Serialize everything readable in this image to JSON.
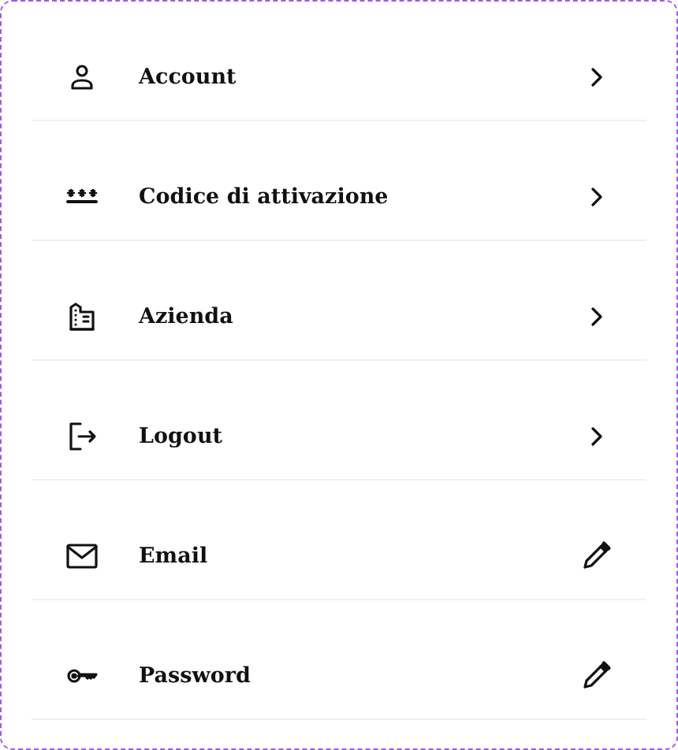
{
  "items": [
    {
      "label": "Account",
      "kind": "navigate"
    },
    {
      "label": "Codice di attivazione",
      "kind": "navigate"
    },
    {
      "label": "Azienda",
      "kind": "navigate"
    },
    {
      "label": "Logout",
      "kind": "navigate"
    },
    {
      "label": "Email",
      "kind": "edit"
    },
    {
      "label": "Password",
      "kind": "edit"
    }
  ]
}
